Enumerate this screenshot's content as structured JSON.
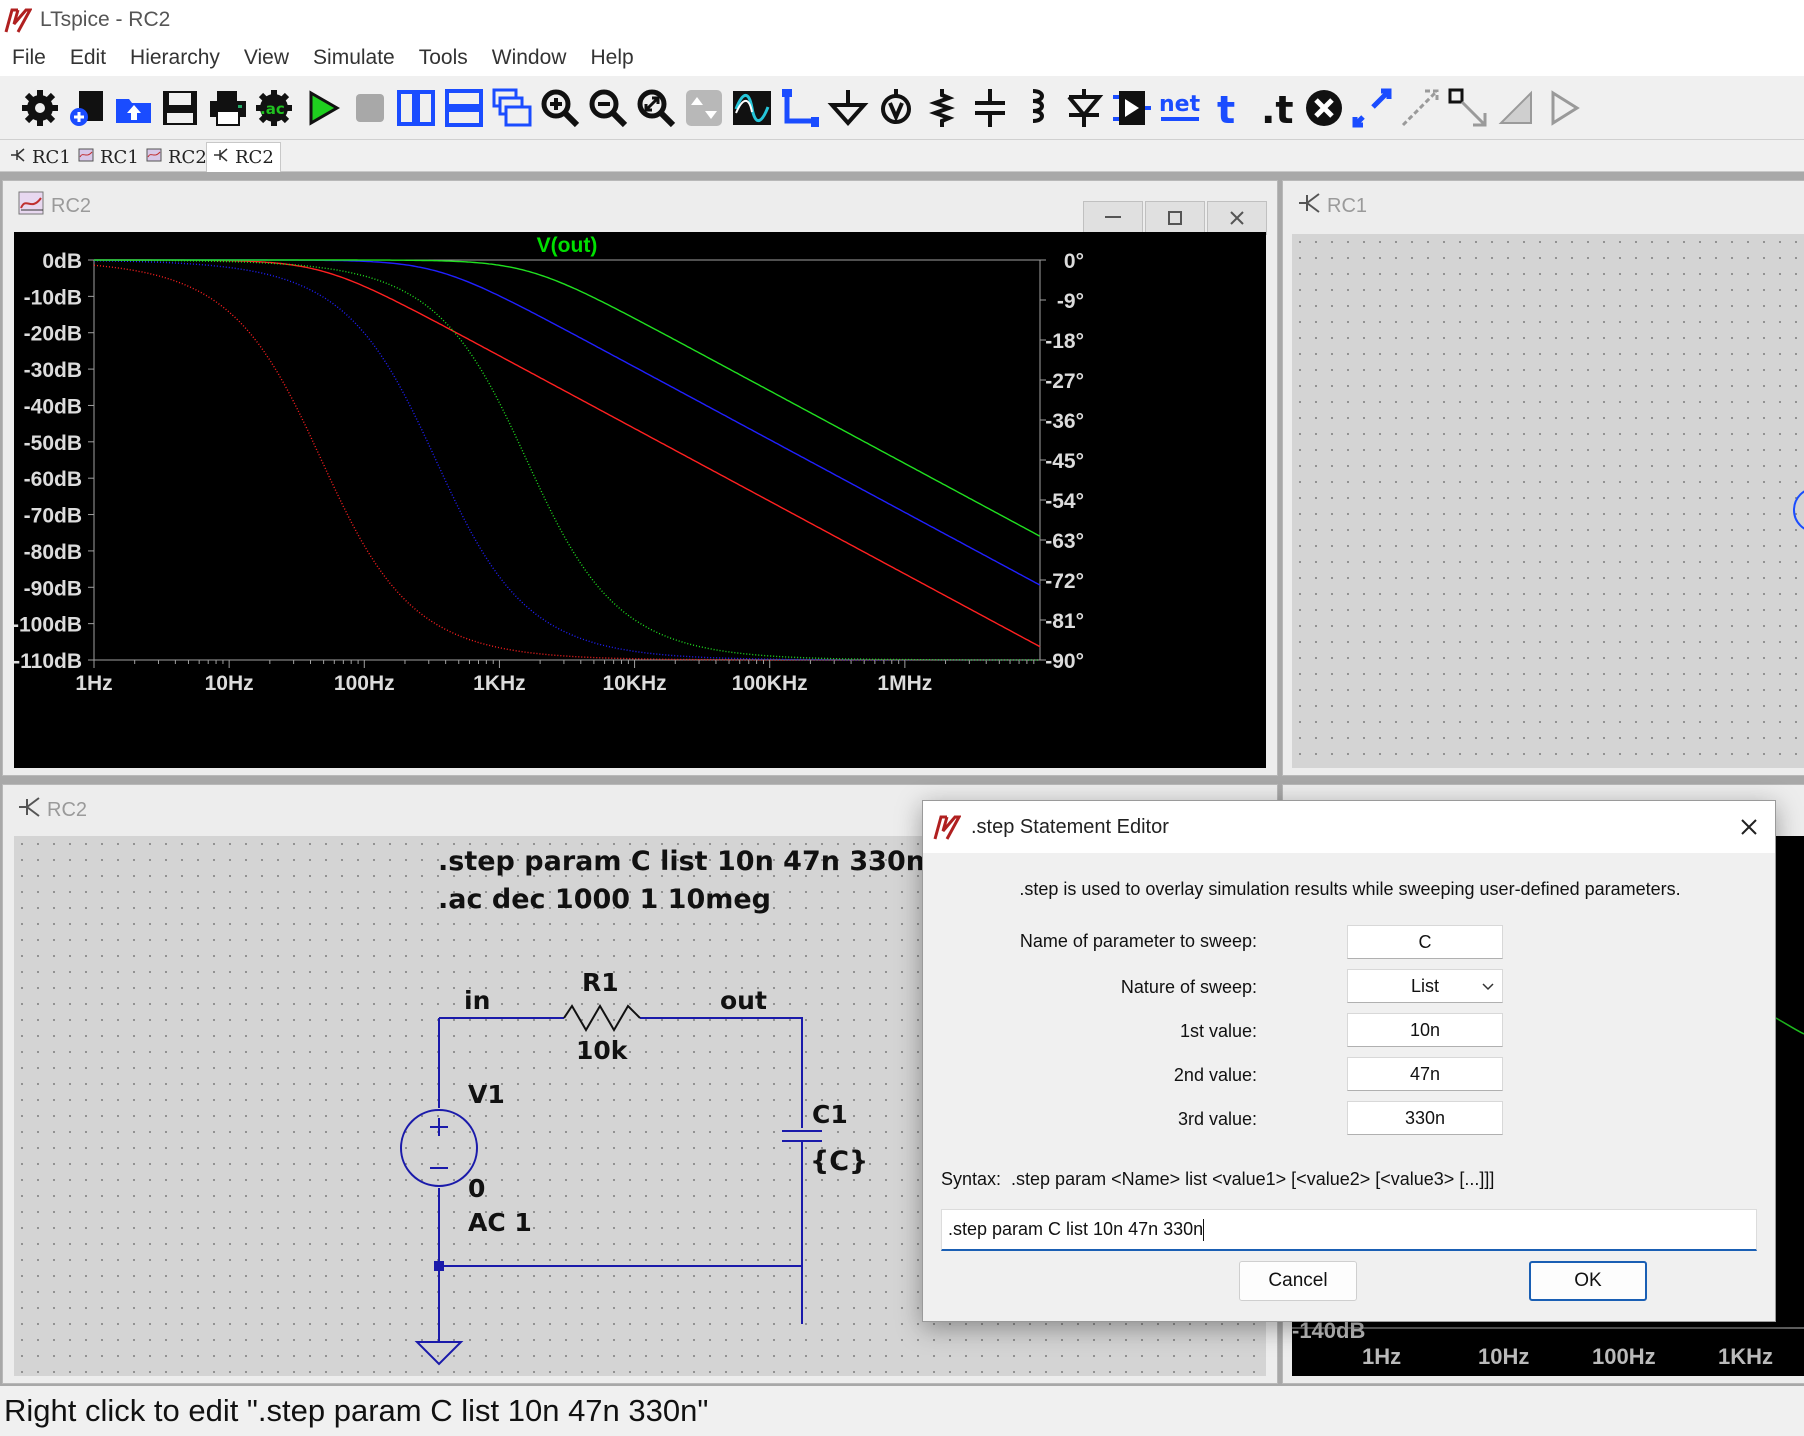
{
  "app": {
    "title": "LTspice - RC2"
  },
  "menu": [
    "File",
    "Edit",
    "Hierarchy",
    "View",
    "Simulate",
    "Tools",
    "Window",
    "Help"
  ],
  "toolbar": {
    "icons": [
      "settings-icon",
      "new-schematic-icon",
      "open-icon",
      "save-icon",
      "print-icon",
      "ac-analysis-icon",
      "run-icon",
      "stop-icon",
      "tile-vertical-icon",
      "tile-horizontal-icon",
      "cascade-icon",
      "zoom-in-icon",
      "zoom-out-icon",
      "zoom-fit-icon",
      "autorange-icon",
      "waveform-icon",
      "wire-icon",
      "ground-icon",
      "voltage-probe-icon",
      "resistor-icon",
      "capacitor-icon",
      "inductor-icon",
      "diode-icon",
      "component-icon",
      "netlabel-icon",
      "text-icon",
      "spice-directive-icon",
      "delete-icon",
      "duplicate-icon",
      "move-icon",
      "drag-icon",
      "undo-icon",
      "redo-icon"
    ],
    "net_label": "net",
    "text_label": "t",
    "directive_label": ".t",
    "ac_label": ".ac"
  },
  "tabs": [
    {
      "label": "RC1",
      "kind": "schematic"
    },
    {
      "label": "RC1",
      "kind": "waveform"
    },
    {
      "label": "RC2",
      "kind": "waveform"
    },
    {
      "label": "RC2",
      "kind": "schematic",
      "active": true
    }
  ],
  "plot_window": {
    "title": "RC2",
    "trace_label": "V(out)",
    "trace_color": "#00e000"
  },
  "chart_data": {
    "type": "line",
    "title": "V(out)",
    "x_scale": "log",
    "x_ticks": [
      "1Hz",
      "10Hz",
      "100Hz",
      "1KHz",
      "10KHz",
      "100KHz",
      "1MHz"
    ],
    "y_ticks_left": [
      "0dB",
      "-10dB",
      "-20dB",
      "-30dB",
      "-40dB",
      "-50dB",
      "-60dB",
      "-70dB",
      "-80dB",
      "-90dB",
      "-100dB",
      "-110dB"
    ],
    "y_ticks_right": [
      "0°",
      "-9°",
      "-18°",
      "-27°",
      "-36°",
      "-45°",
      "-54°",
      "-63°",
      "-72°",
      "-81°",
      "-90°"
    ],
    "xlim_hz": [
      1,
      10000000
    ],
    "ylim_db": [
      -110,
      0
    ],
    "ylim_deg": [
      -90,
      0
    ],
    "series": [
      {
        "color": "#ff2020",
        "param": "C=330n",
        "magnitude": true,
        "cutoff_hz": 48.2
      },
      {
        "color": "#2020ff",
        "param": "C=47n",
        "magnitude": true,
        "cutoff_hz": 338.6
      },
      {
        "color": "#20e020",
        "param": "C=10n",
        "magnitude": true,
        "cutoff_hz": 1591.5
      },
      {
        "color": "#ff2020",
        "param": "C=330n",
        "phase": true,
        "cutoff_hz": 48.2
      },
      {
        "color": "#2020ff",
        "param": "C=47n",
        "phase": true,
        "cutoff_hz": 338.6
      },
      {
        "color": "#20e020",
        "param": "C=10n",
        "phase": true,
        "cutoff_hz": 1591.5
      }
    ]
  },
  "rc1_window": {
    "title": "RC1"
  },
  "schematic_window": {
    "title": "RC2",
    "directive_step": ".step param C list 10n 47n 330n",
    "directive_ac": ".ac dec 1000 1 10meg",
    "labels": {
      "in": "in",
      "out": "out",
      "r_name": "R1",
      "r_value": "10k",
      "v_name": "V1",
      "v_dc": "0",
      "v_ac": "AC 1",
      "c_name": "C1",
      "c_value": "{C}"
    }
  },
  "partial_plot": {
    "y_label": "-140dB",
    "x_ticks": [
      "1Hz",
      "10Hz",
      "100Hz",
      "1KHz"
    ]
  },
  "dialog": {
    "title": ".step Statement Editor",
    "description": ".step is used to overlay simulation results while sweeping user-defined parameters.",
    "param_label": "Name of parameter to sweep:",
    "param_value": "C",
    "nature_label": "Nature of sweep:",
    "nature_value": "List",
    "v1_label": "1st value:",
    "v1": "10n",
    "v2_label": "2nd value:",
    "v2": "47n",
    "v3_label": "3rd value:",
    "v3": "330n",
    "syntax": "Syntax:  .step param <Name> list <value1> [<value2> [<value3> [...]]]",
    "command": ".step param C list 10n 47n 330n",
    "cancel": "Cancel",
    "ok": "OK"
  },
  "status": {
    "text": "Right click to edit \".step param C list 10n 47n 330n\""
  }
}
